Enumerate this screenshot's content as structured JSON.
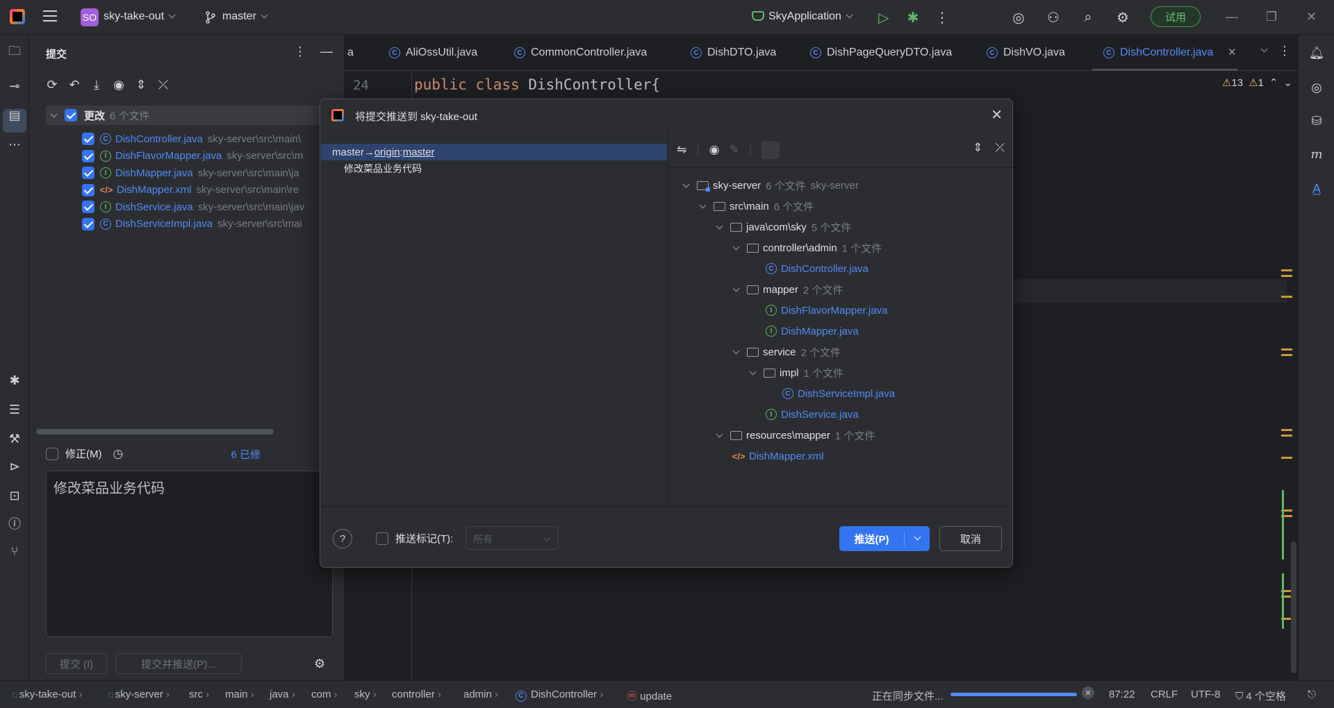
{
  "titlebar": {
    "project_badge": "SO",
    "project_name": "sky-take-out",
    "branch": "master",
    "run_config": "SkyApplication",
    "trial_label": "试用"
  },
  "commit_panel": {
    "title": "提交",
    "group_label": "更改",
    "group_count": "6 个文件",
    "files": [
      {
        "name": "DishController.java",
        "path": "sky-server\\src\\main\\",
        "kind": "class"
      },
      {
        "name": "DishFlavorMapper.java",
        "path": "sky-server\\src\\m",
        "kind": "interface"
      },
      {
        "name": "DishMapper.java",
        "path": "sky-server\\src\\main\\ja",
        "kind": "interface"
      },
      {
        "name": "DishMapper.xml",
        "path": "sky-server\\src\\main\\re",
        "kind": "xml"
      },
      {
        "name": "DishService.java",
        "path": "sky-server\\src\\main\\jav",
        "kind": "interface"
      },
      {
        "name": "DishServiceImpl.java",
        "path": "sky-server\\src\\mai",
        "kind": "class"
      }
    ],
    "amend_label": "修正(M)",
    "modified_count": "6 已修",
    "message": "修改菜品业务代码",
    "commit_button": "提交 (I)",
    "commit_push_button": "提交并推送(P)..."
  },
  "editor": {
    "tabs": [
      {
        "label": "a",
        "kind": "none"
      },
      {
        "label": "AliOssUtil.java",
        "kind": "class"
      },
      {
        "label": "CommonController.java",
        "kind": "class"
      },
      {
        "label": "DishDTO.java",
        "kind": "class"
      },
      {
        "label": "DishPageQueryDTO.java",
        "kind": "class"
      },
      {
        "label": "DishVO.java",
        "kind": "class"
      },
      {
        "label": "DishController.java",
        "kind": "class"
      }
    ],
    "line_number": "24",
    "code_keyword": "public class",
    "code_rest": " DishController{",
    "warnings": "13",
    "weak_warnings": "1"
  },
  "dialog": {
    "title": "将提交推送到 sky-take-out",
    "push_source": "master",
    "push_arrow": " → ",
    "push_remote": "origin",
    "push_colon": " : ",
    "push_target": "master",
    "commit_message": "修改菜品业务代码",
    "tree": [
      {
        "label": "sky-server",
        "count": "6 个文件",
        "extra": "sky-server",
        "type": "module"
      },
      {
        "label": "src\\main",
        "count": "6 个文件",
        "type": "folder"
      },
      {
        "label": "java\\com\\sky",
        "count": "5 个文件",
        "type": "folder"
      },
      {
        "label": "controller\\admin",
        "count": "1 个文件",
        "type": "folder"
      },
      {
        "label": "DishController.java",
        "type": "class"
      },
      {
        "label": "mapper",
        "count": "2 个文件",
        "type": "folder"
      },
      {
        "label": "DishFlavorMapper.java",
        "type": "interface"
      },
      {
        "label": "DishMapper.java",
        "type": "interface"
      },
      {
        "label": "service",
        "count": "2 个文件",
        "type": "folder"
      },
      {
        "label": "impl",
        "count": "1 个文件",
        "type": "folder"
      },
      {
        "label": "DishServiceImpl.java",
        "type": "class"
      },
      {
        "label": "DishService.java",
        "type": "interface"
      },
      {
        "label": "resources\\mapper",
        "count": "1 个文件",
        "type": "folder"
      },
      {
        "label": "DishMapper.xml",
        "type": "xml"
      }
    ],
    "push_tags_label": "推送标记(T):",
    "tags_select_value": "所有",
    "push_button": "推送(P)",
    "cancel_button": "取消",
    "help": "?"
  },
  "statusbar": {
    "breadcrumbs": [
      "sky-take-out",
      "sky-server",
      "src",
      "main",
      "java",
      "com",
      "sky",
      "controller",
      "admin",
      "DishController",
      "update"
    ],
    "sync_text": "正在同步文件...",
    "sync_progress": 1.0,
    "position": "87:22",
    "line_ending": "CRLF",
    "encoding": "UTF-8",
    "indent": "4 个空格"
  },
  "colors": {
    "accent": "#3574f0",
    "file_link": "#548af7",
    "interface_icon": "#5fb865",
    "xml_icon": "#e08855",
    "keyword": "#cf8e6d",
    "trial": "#6ac06f"
  }
}
